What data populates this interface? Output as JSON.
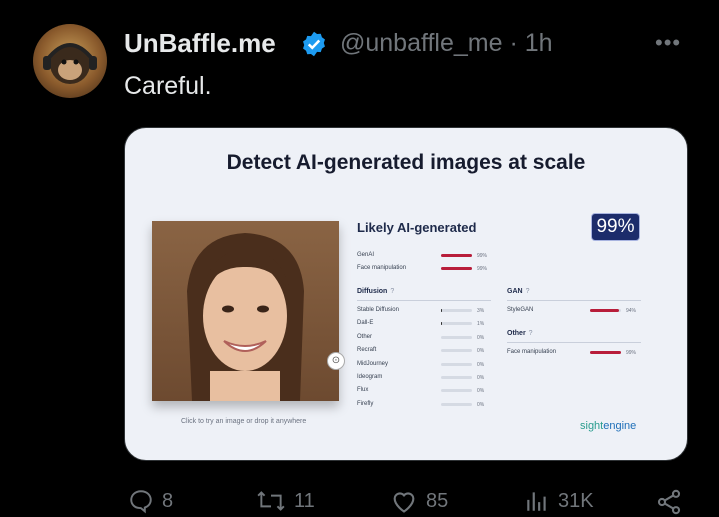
{
  "tweet": {
    "display_name": "UnBaffle.me",
    "handle": "@unbaffle_me",
    "time": "· 1h",
    "more": "•••",
    "text": "Careful."
  },
  "card": {
    "title": "Detect AI-generated images at scale",
    "likely_label": "Likely AI-generated",
    "score": "99%",
    "drop_hint": "Click to try an image or drop it anywhere",
    "upload_icon": "⊙",
    "brand_part1": "sight",
    "brand_part2": "engine",
    "summary": [
      {
        "label": "GenAI",
        "pct": "99%",
        "value": 0.99
      },
      {
        "label": "Face manipulation",
        "pct": "99%",
        "value": 0.99
      }
    ],
    "diffusion": {
      "heading": "Diffusion",
      "help": "?",
      "rows": [
        {
          "label": "Stable Diffusion",
          "pct": "3%",
          "value": 0.03
        },
        {
          "label": "Dall-E",
          "pct": "1%",
          "value": 0.01
        },
        {
          "label": "Other",
          "pct": "0%",
          "value": 0
        },
        {
          "label": "Recraft",
          "pct": "0%",
          "value": 0
        },
        {
          "label": "MidJourney",
          "pct": "0%",
          "value": 0
        },
        {
          "label": "Ideogram",
          "pct": "0%",
          "value": 0
        },
        {
          "label": "Flux",
          "pct": "0%",
          "value": 0
        },
        {
          "label": "Firefly",
          "pct": "0%",
          "value": 0
        }
      ]
    },
    "gan": {
      "heading": "GAN",
      "help": "?",
      "rows": [
        {
          "label": "StyleGAN",
          "pct": "94%",
          "value": 0.94
        }
      ]
    },
    "other": {
      "heading": "Other",
      "help": "?",
      "rows": [
        {
          "label": "Face manipulation",
          "pct": "99%",
          "value": 0.99
        }
      ]
    }
  },
  "actions": {
    "replies": "8",
    "reposts": "11",
    "likes": "85",
    "views": "31K"
  },
  "colors": {
    "accent_bar": "#b81d3a",
    "verified": "#1d9bf0",
    "badge_bg": "#1c2c6b"
  }
}
